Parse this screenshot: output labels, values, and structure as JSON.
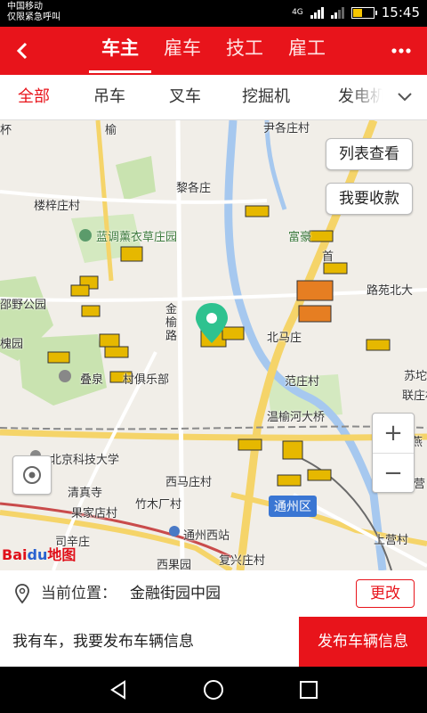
{
  "status": {
    "carrier": "中国移动",
    "emergency": "仅限紧急呼叫",
    "network": "4G",
    "time": "15:45"
  },
  "appbar": {
    "back_icon": "chevron-left-icon",
    "tabs": [
      "车主",
      "雇车",
      "技工",
      "雇工"
    ],
    "active_tab": 0,
    "more_icon": "more-dots-icon"
  },
  "categories": {
    "items": [
      "全部",
      "吊车",
      "叉车",
      "挖掘机",
      "发电机"
    ],
    "active": 0,
    "expand_icon": "chevron-down-icon"
  },
  "map": {
    "list_view_button": "列表查看",
    "collect_button": "我要收款",
    "zoom_in": "+",
    "zoom_out": "−",
    "locate_icon": "locate-icon",
    "logo_text": "Bai",
    "logo_paw": "du",
    "logo_suffix": "地图",
    "labels": {
      "l1": "尹各庄村",
      "l2": "黎各庄",
      "l3": "楼梓庄村",
      "l4": "蓝调薰衣草庄园",
      "l5": "富豪",
      "l6": "路苑北大",
      "l7": "邵野公园",
      "l8": "北马庄",
      "l9": "槐园",
      "l10": "叠泉",
      "l11": "村俱乐部",
      "l12": "苏坨",
      "l13": "范庄村",
      "l14": "联庄村",
      "l15": "温榆河大桥",
      "l16": "北京科技大学",
      "l17": "西马庄村",
      "l18": "西营",
      "l19": "清真寺",
      "l20": "竹木厂村",
      "l21": "果家店村",
      "l22": "司辛庄",
      "l23": "通州西站",
      "l24": "上营村",
      "l25": "西果园",
      "l26": "复兴庄村",
      "l27": "通州区",
      "l28": "金榆路",
      "l29": "榆",
      "l30": "首",
      "l31": "燕",
      "l32": "杯"
    }
  },
  "location": {
    "pin_icon": "location-pin-icon",
    "label": "当前位置：",
    "value": "金融街园中园",
    "change_button": "更改"
  },
  "publish": {
    "text": "我有车，我要发布车辆信息",
    "button": "发布车辆信息"
  },
  "colors": {
    "brand_red": "#e8141b",
    "map_green": "#c9e3b0",
    "road_yellow": "#f5d469",
    "river_blue": "#a6c8ef",
    "marker_teal": "#2ec28f"
  }
}
